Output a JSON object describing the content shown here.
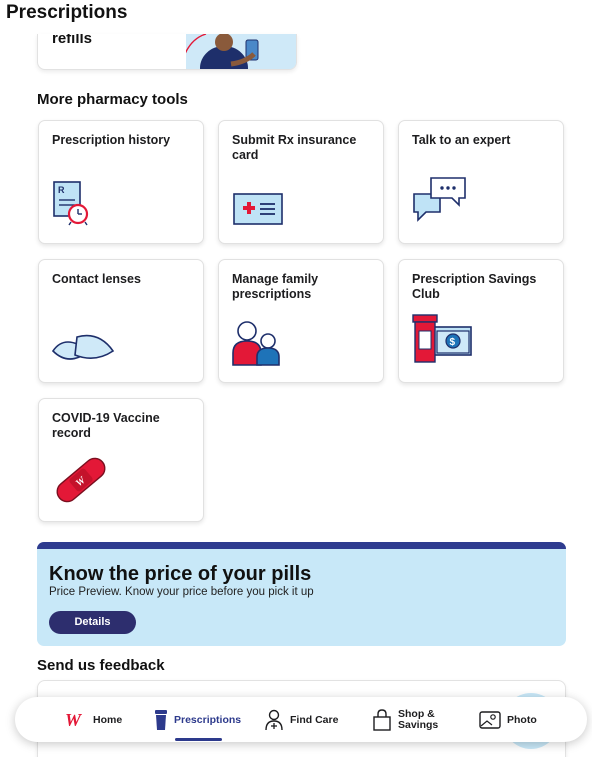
{
  "header": {
    "title": "Prescriptions"
  },
  "top_card": {
    "text": "refills"
  },
  "tools": {
    "title": "More pharmacy tools",
    "items": [
      {
        "label": "Prescription history",
        "icon": "rx-history-clock-icon"
      },
      {
        "label": "Submit Rx insurance card",
        "icon": "insurance-card-icon"
      },
      {
        "label": "Talk to an expert",
        "icon": "chat-bubbles-icon"
      },
      {
        "label": "Contact lenses",
        "icon": "contact-lenses-icon"
      },
      {
        "label": "Manage family prescriptions",
        "icon": "family-icon"
      },
      {
        "label": "Prescription Savings Club",
        "icon": "savings-club-icon"
      },
      {
        "label": "COVID-19 Vaccine record",
        "icon": "bandage-icon"
      }
    ]
  },
  "banner": {
    "title": "Know the price of your pills",
    "subtitle": "Price Preview. Know your price before you pick it up",
    "button": "Details"
  },
  "feedback": {
    "title": "Send us feedback"
  },
  "nav": {
    "items": [
      {
        "label": "Home",
        "icon": "walgreens-logo-icon"
      },
      {
        "label": "Prescriptions",
        "icon": "pill-bottle-icon",
        "active": true
      },
      {
        "label": "Find Care",
        "icon": "find-care-icon"
      },
      {
        "label_line1": "Shop &",
        "label_line2": "Savings",
        "icon": "shopping-bag-icon"
      },
      {
        "label": "Photo",
        "icon": "photo-icon"
      }
    ]
  },
  "colors": {
    "accent": "#2d3a8c",
    "banner_bg": "#c8e8f8",
    "brand_red": "#e31837"
  }
}
